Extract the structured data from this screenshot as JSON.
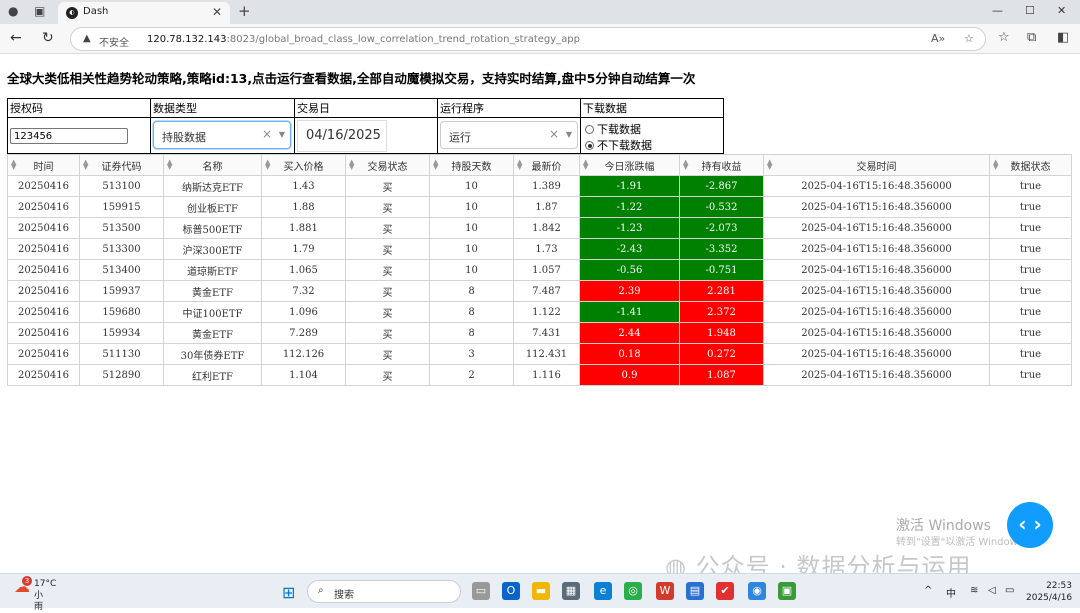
{
  "browser": {
    "tab_title": "Dash",
    "tab_favicon": "dash",
    "tab_close": "✕",
    "new_tab": "+",
    "insecure_label": "不安全",
    "url_host": "120.78.132.143",
    "url_path": ":8023/global_broad_class_low_correlation_trend_rotation_strategy_app",
    "window_controls": [
      "—",
      "☐",
      "✕"
    ]
  },
  "page": {
    "heading": "全球大类低相关性趋势轮动策略,策略id:13,点击运行查看数据,全部自动魔模拟交易，支持实时结算,盘中5分钟自动结算一次",
    "controls": {
      "labels": [
        "授权码",
        "数据类型",
        "交易日",
        "运行程序",
        "下载数据"
      ],
      "auth_code": "123456",
      "data_type": "持股数据",
      "trade_date": "04/16/2025",
      "run_program": "运行",
      "download_options": [
        "下载数据",
        "不下载数据"
      ],
      "download_selected": 1
    },
    "table": {
      "columns": [
        "时间",
        "证券代码",
        "名称",
        "买入价格",
        "交易状态",
        "持股天数",
        "最新价",
        "今日涨跌幅",
        "持有收益",
        "交易时间",
        "数据状态"
      ],
      "rows": [
        [
          "20250416",
          "513100",
          "纳斯达克ETF",
          "1.43",
          "买",
          "10",
          "1.389",
          "-1.91",
          "-2.867",
          "2025-04-16T15:16:48.356000",
          "true"
        ],
        [
          "20250416",
          "159915",
          "创业板ETF",
          "1.88",
          "买",
          "10",
          "1.87",
          "-1.22",
          "-0.532",
          "2025-04-16T15:16:48.356000",
          "true"
        ],
        [
          "20250416",
          "513500",
          "标普500ETF",
          "1.881",
          "买",
          "10",
          "1.842",
          "-1.23",
          "-2.073",
          "2025-04-16T15:16:48.356000",
          "true"
        ],
        [
          "20250416",
          "513300",
          "沪深300ETF",
          "1.79",
          "买",
          "10",
          "1.73",
          "-2.43",
          "-3.352",
          "2025-04-16T15:16:48.356000",
          "true"
        ],
        [
          "20250416",
          "513400",
          "道琼斯ETF",
          "1.065",
          "买",
          "10",
          "1.057",
          "-0.56",
          "-0.751",
          "2025-04-16T15:16:48.356000",
          "true"
        ],
        [
          "20250416",
          "159937",
          "黄金ETF",
          "7.32",
          "买",
          "8",
          "7.487",
          "2.39",
          "2.281",
          "2025-04-16T15:16:48.356000",
          "true"
        ],
        [
          "20250416",
          "159680",
          "中证100ETF",
          "1.096",
          "买",
          "8",
          "1.122",
          "-1.41",
          "2.372",
          "2025-04-16T15:16:48.356000",
          "true"
        ],
        [
          "20250416",
          "159934",
          "黄金ETF",
          "7.289",
          "买",
          "8",
          "7.431",
          "2.44",
          "1.948",
          "2025-04-16T15:16:48.356000",
          "true"
        ],
        [
          "20250416",
          "511130",
          "30年债券ETF",
          "112.126",
          "买",
          "3",
          "112.431",
          "0.18",
          "0.272",
          "2025-04-16T15:16:48.356000",
          "true"
        ],
        [
          "20250416",
          "512890",
          "红利ETF",
          "1.104",
          "买",
          "2",
          "1.116",
          "0.9",
          "1.087",
          "2025-04-16T15:16:48.356000",
          "true"
        ]
      ],
      "positive_color": "#ff0000",
      "negative_color": "#008000"
    },
    "fab_label": "‹ ›",
    "windows_activate_title": "激活 Windows",
    "windows_activate_sub": "转到\"设置\"以激活 Windows。",
    "wechat_watermark": "公众号 · 数据分析与运用"
  },
  "taskbar": {
    "temperature": "17°C",
    "weather": "小雨",
    "weather_badge": "3",
    "search_label": "搜索",
    "ime": "中",
    "time": "22:53",
    "date": "2025/4/16"
  }
}
